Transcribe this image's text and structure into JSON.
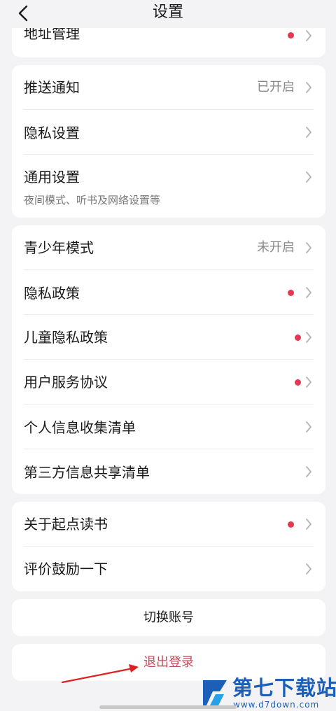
{
  "header": {
    "title": "设置"
  },
  "card0": {
    "items": [
      {
        "label": "地址管理",
        "dot": true
      }
    ]
  },
  "card1": {
    "items": [
      {
        "label": "推送通知",
        "value": "已开启"
      },
      {
        "label": "隐私设置"
      },
      {
        "label": "通用设置",
        "sub": "夜间模式、听书及网络设置等"
      }
    ]
  },
  "card2": {
    "items": [
      {
        "label": "青少年模式",
        "value": "未开启"
      },
      {
        "label": "隐私政策",
        "dot": true
      },
      {
        "label": "儿童隐私政策",
        "dot": true
      },
      {
        "label": "用户服务协议",
        "dot": true
      },
      {
        "label": "个人信息收集清单"
      },
      {
        "label": "第三方信息共享清单"
      }
    ]
  },
  "card3": {
    "items": [
      {
        "label": "关于起点读书",
        "dot": true
      },
      {
        "label": "评价鼓励一下"
      }
    ]
  },
  "switch_account": {
    "label": "切换账号"
  },
  "logout": {
    "label": "退出登录"
  },
  "watermark": {
    "title": "第七下载站",
    "url": "www.d7down.com"
  },
  "colors": {
    "accent_red": "#e8364f",
    "logout_red": "#c84a5c",
    "watermark_blue": "#1c5fb8",
    "background": "#f3f3f5"
  }
}
